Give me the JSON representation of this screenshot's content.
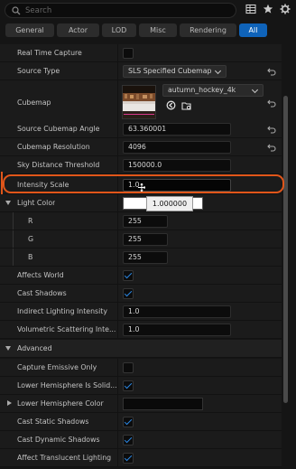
{
  "search": {
    "placeholder": "Search"
  },
  "filters": [
    "General",
    "Actor",
    "LOD",
    "Misc",
    "Rendering",
    "All"
  ],
  "active_filter": "All",
  "properties": {
    "real_time_capture": {
      "label": "Real Time Capture",
      "checked": false
    },
    "source_type": {
      "label": "Source Type",
      "value": "SLS Specified Cubemap"
    },
    "cubemap": {
      "label": "Cubemap",
      "asset": "autumn_hockey_4k"
    },
    "source_cubemap_angle": {
      "label": "Source Cubemap Angle",
      "value": "63.360001"
    },
    "cubemap_resolution": {
      "label": "Cubemap Resolution",
      "value": "4096"
    },
    "sky_distance_threshold": {
      "label": "Sky Distance Threshold",
      "value": "150000.0"
    },
    "intensity_scale": {
      "label": "Intensity Scale",
      "value": "1.0"
    },
    "light_color": {
      "label": "Light Color",
      "r_label": "R",
      "g_label": "G",
      "b_label": "B",
      "r": "255",
      "g": "255",
      "b": "255"
    },
    "affects_world": {
      "label": "Affects World",
      "checked": true
    },
    "cast_shadows": {
      "label": "Cast Shadows",
      "checked": true
    },
    "indirect_lighting_intensity": {
      "label": "Indirect Lighting Intensity",
      "value": "1.0"
    },
    "volumetric_scattering_intensity": {
      "label": "Volumetric Scattering Inte...",
      "value": "1.0"
    }
  },
  "advanced": {
    "header": "Advanced",
    "capture_emissive_only": {
      "label": "Capture Emissive Only",
      "checked": false
    },
    "lower_hemisphere_is_solid": {
      "label": "Lower Hemisphere Is Solid...",
      "checked": true
    },
    "lower_hemisphere_color": {
      "label": "Lower Hemisphere Color"
    },
    "cast_static_shadows": {
      "label": "Cast Static Shadows",
      "checked": true
    },
    "cast_dynamic_shadows": {
      "label": "Cast Dynamic Shadows",
      "checked": true
    },
    "affect_translucent_lighting": {
      "label": "Affect Translucent Lighting",
      "checked": true
    }
  },
  "tooltip": {
    "value": "1.000000"
  },
  "colors": {
    "accent": "#0f63b9",
    "highlight": "#e1561a",
    "check": "#2b86e0"
  }
}
